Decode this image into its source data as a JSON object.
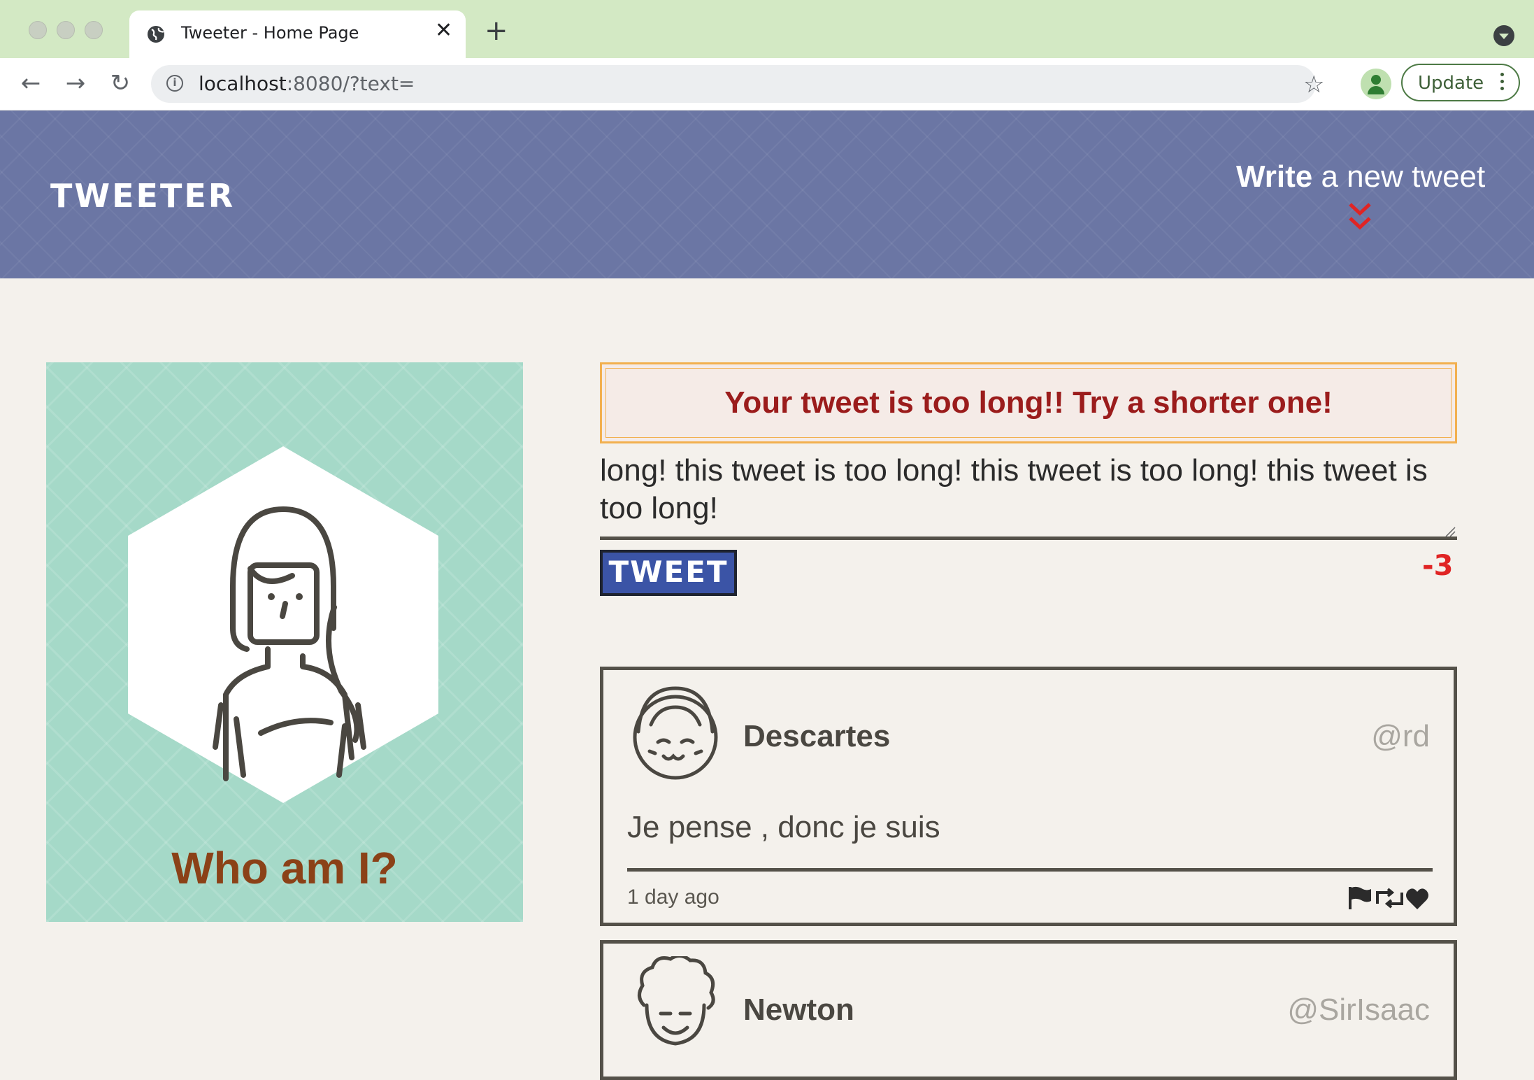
{
  "browser": {
    "tab_title": "Tweeter - Home Page",
    "url_host": "localhost",
    "url_rest": ":8080/?text=",
    "update_label": "Update"
  },
  "header": {
    "logo": "TWEETER",
    "compose_bold": "Write",
    "compose_rest": " a new tweet"
  },
  "profile": {
    "title": "Who am I?"
  },
  "compose": {
    "error": "Your tweet is too long!! Try a shorter one!",
    "text": "long! this tweet is too long! this tweet is too long! this tweet is too long!",
    "button_label": "TWEET",
    "counter": "-3"
  },
  "tweets": [
    {
      "name": "Descartes",
      "handle": "@rd",
      "content": "Je pense , donc je suis",
      "time": "1 day ago"
    },
    {
      "name": "Newton",
      "handle": "@SirIsaac"
    }
  ],
  "colors": {
    "header_bg": "#6b76a4",
    "profile_bg": "#a5d9c8",
    "accent_red": "#e02424",
    "button_blue": "#3b54a6",
    "error_text": "#9b1c1c"
  }
}
